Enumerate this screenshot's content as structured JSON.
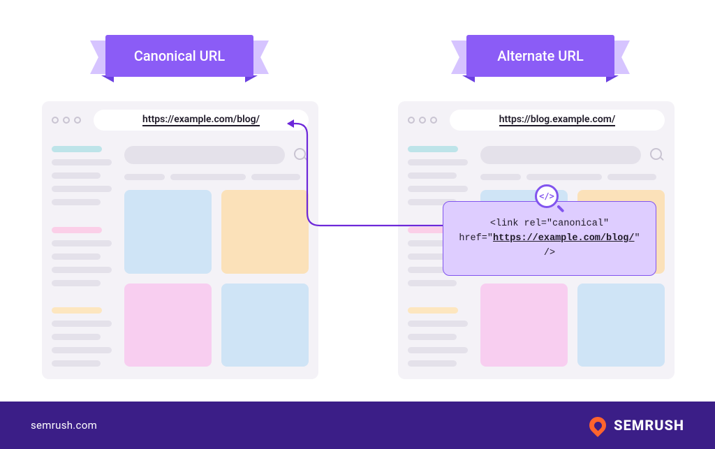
{
  "banners": {
    "left": "Canonical URL",
    "right": "Alternate URL"
  },
  "browsers": {
    "left_url": "https://example.com/blog/",
    "right_url": "https://blog.example.com/"
  },
  "bubble": {
    "line1_pre": "<link rel=\"canonical\"",
    "line2_pre": "href=\"",
    "line2_url": "https://example.com/blog/",
    "line2_post": "\" />",
    "icon_glyph": "</>"
  },
  "footer": {
    "site": "semrush.com",
    "brand": "SEMRUSH"
  }
}
